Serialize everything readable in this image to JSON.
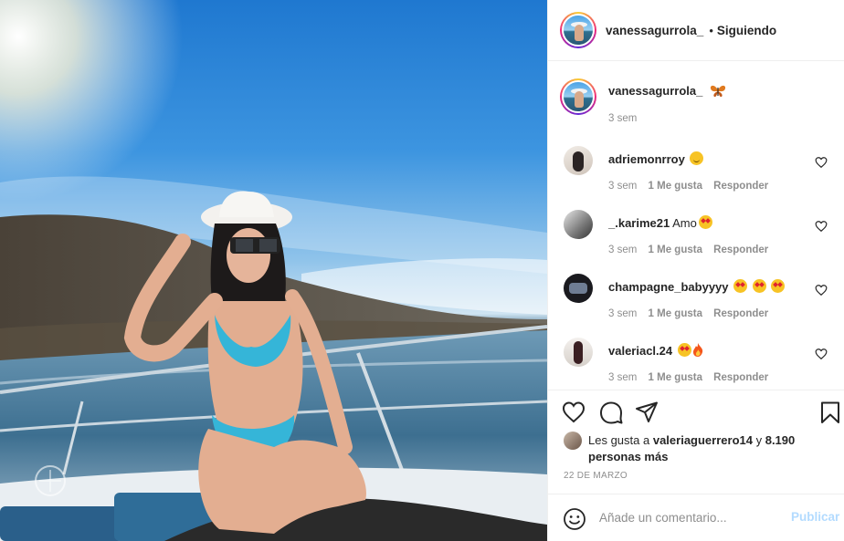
{
  "header": {
    "username": "vanessagurrola_",
    "separator": "•",
    "follow_status": "Siguiendo"
  },
  "caption": {
    "username": "vanessagurrola_",
    "time": "3 sem"
  },
  "comments": [
    {
      "username": "adriemonrroy",
      "text": "",
      "time": "3 sem",
      "likes": "1 Me gusta",
      "reply": "Responder"
    },
    {
      "username": "_.karime21",
      "text": "Amo",
      "time": "3 sem",
      "likes": "1 Me gusta",
      "reply": "Responder"
    },
    {
      "username": "champagne_babyyyy",
      "text": "",
      "time": "3 sem",
      "likes": "1 Me gusta",
      "reply": "Responder"
    },
    {
      "username": "valeriacl.24",
      "text": "",
      "time": "3 sem",
      "likes": "1 Me gusta",
      "reply": "Responder"
    }
  ],
  "likes": {
    "prefix": "Les gusta a",
    "user": "valeriaguerrero14",
    "suffix": "y",
    "others": "8.190 personas más"
  },
  "date": "22 DE MARZO",
  "add_comment": {
    "placeholder": "Añade un comentario...",
    "publish": "Publicar"
  },
  "icons": [
    "heart-icon",
    "comment-icon",
    "share-icon",
    "bookmark-icon",
    "emoji-icon",
    "butterfly-icon",
    "star-eyes-emoji",
    "fire-emoji",
    "smile-emoji"
  ],
  "colors": {
    "accent": "#0095f6",
    "publish_disabled": "#b3dbff",
    "muted": "#8e8e8e",
    "border": "#efefef"
  }
}
